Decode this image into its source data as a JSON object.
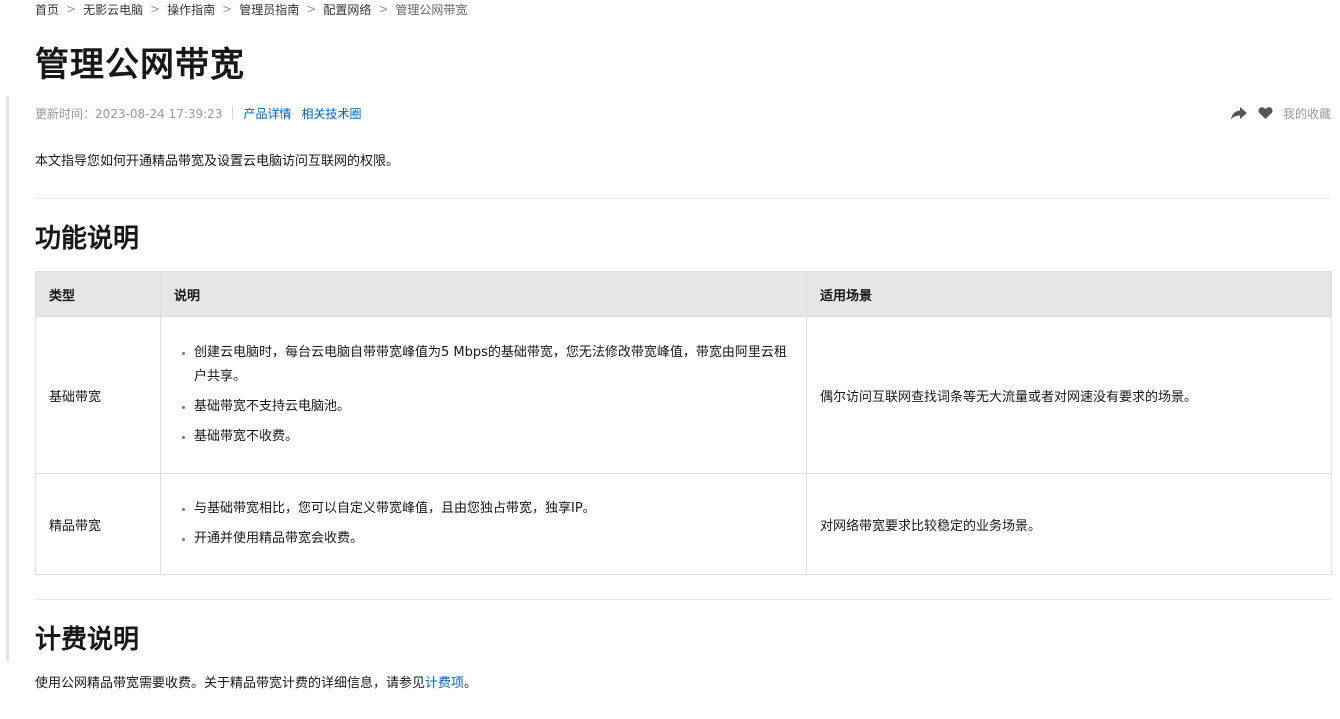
{
  "breadcrumb": {
    "items": [
      "首页",
      "无影云电脑",
      "操作指南",
      "管理员指南",
      "配置网络"
    ],
    "current": "管理公网带宽",
    "separator": ">"
  },
  "page": {
    "title": "管理公网带宽",
    "updated": "更新时间：2023-08-24 17:39:23",
    "links": [
      "产品详情",
      "相关技术圈"
    ],
    "favorites_label": "我的收藏",
    "intro": "本文指导您如何开通精品带宽及设置云电脑访问互联网的权限。"
  },
  "features": {
    "heading": "功能说明",
    "columns": [
      "类型",
      "说明",
      "适用场景"
    ],
    "rows": [
      {
        "type": "基础带宽",
        "desc": [
          "创建云电脑时，每台云电脑自带带宽峰值为5 Mbps的基础带宽，您无法修改带宽峰值，带宽由阿里云租户共享。",
          "基础带宽不支持云电脑池。",
          "基础带宽不收费。"
        ],
        "scenario": "偶尔访问互联网查找词条等无大流量或者对网速没有要求的场景。"
      },
      {
        "type": "精品带宽",
        "desc": [
          "与基础带宽相比，您可以自定义带宽峰值，且由您独占带宽，独享IP。",
          "开通并使用精品带宽会收费。"
        ],
        "scenario": "对网络带宽要求比较稳定的业务场景。"
      }
    ]
  },
  "billing": {
    "heading": "计费说明",
    "text_before": "使用公网精品带宽需要收费。关于精品带宽计费的详细信息，请参见",
    "link": "计费项",
    "text_after": "。"
  },
  "colors": {
    "link": "#0064c8",
    "table_header_bg": "#e6e6e6",
    "border": "#dedede"
  },
  "icons": {
    "share": "share-icon",
    "favorite": "heart-icon"
  }
}
